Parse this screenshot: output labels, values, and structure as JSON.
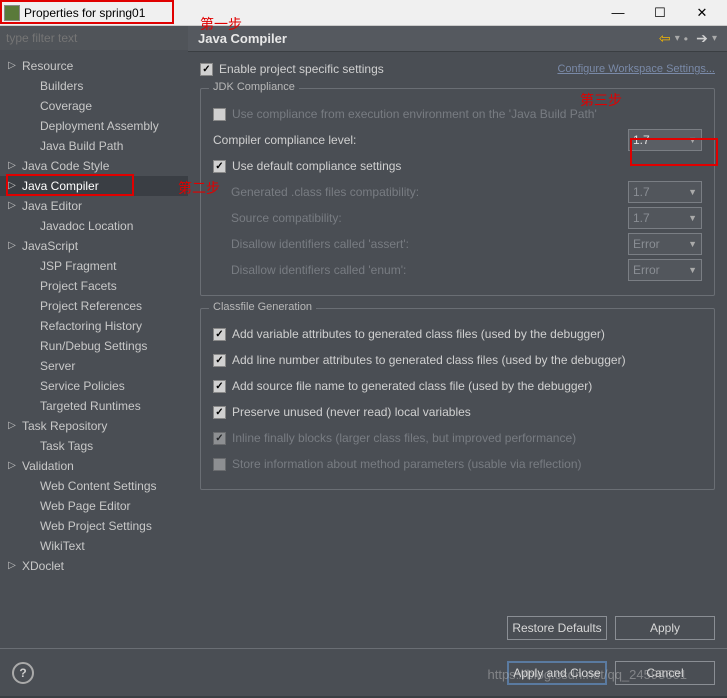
{
  "title": "Properties for spring01",
  "filter_placeholder": "type filter text",
  "tree": [
    {
      "label": "Resource",
      "exp": true,
      "child": false
    },
    {
      "label": "Builders",
      "exp": false,
      "child": true
    },
    {
      "label": "Coverage",
      "exp": false,
      "child": true
    },
    {
      "label": "Deployment Assembly",
      "exp": false,
      "child": true
    },
    {
      "label": "Java Build Path",
      "exp": false,
      "child": true
    },
    {
      "label": "Java Code Style",
      "exp": true,
      "child": false
    },
    {
      "label": "Java Compiler",
      "exp": true,
      "child": false,
      "selected": true
    },
    {
      "label": "Java Editor",
      "exp": true,
      "child": false
    },
    {
      "label": "Javadoc Location",
      "exp": false,
      "child": true
    },
    {
      "label": "JavaScript",
      "exp": true,
      "child": false
    },
    {
      "label": "JSP Fragment",
      "exp": false,
      "child": true
    },
    {
      "label": "Project Facets",
      "exp": false,
      "child": true
    },
    {
      "label": "Project References",
      "exp": false,
      "child": true
    },
    {
      "label": "Refactoring History",
      "exp": false,
      "child": true
    },
    {
      "label": "Run/Debug Settings",
      "exp": false,
      "child": true
    },
    {
      "label": "Server",
      "exp": false,
      "child": true
    },
    {
      "label": "Service Policies",
      "exp": false,
      "child": true
    },
    {
      "label": "Targeted Runtimes",
      "exp": false,
      "child": true
    },
    {
      "label": "Task Repository",
      "exp": true,
      "child": false
    },
    {
      "label": "Task Tags",
      "exp": false,
      "child": true
    },
    {
      "label": "Validation",
      "exp": true,
      "child": false
    },
    {
      "label": "Web Content Settings",
      "exp": false,
      "child": true
    },
    {
      "label": "Web Page Editor",
      "exp": false,
      "child": true
    },
    {
      "label": "Web Project Settings",
      "exp": false,
      "child": true
    },
    {
      "label": "WikiText",
      "exp": false,
      "child": true
    },
    {
      "label": "XDoclet",
      "exp": true,
      "child": false
    }
  ],
  "header": {
    "title": "Java Compiler"
  },
  "enable_specific": "Enable project specific settings",
  "configure_link": "Configure Workspace Settings...",
  "jdk": {
    "group": "JDK Compliance",
    "use_exec_env": "Use compliance from execution environment on the 'Java Build Path'",
    "compliance_label": "Compiler compliance level:",
    "compliance_value": "1.7",
    "use_default": "Use default compliance settings",
    "gen_compat": "Generated .class files compatibility:",
    "gen_compat_val": "1.7",
    "src_compat": "Source compatibility:",
    "src_compat_val": "1.7",
    "assert": "Disallow identifiers called 'assert':",
    "assert_val": "Error",
    "enum": "Disallow identifiers called 'enum':",
    "enum_val": "Error"
  },
  "classfile": {
    "group": "Classfile Generation",
    "var_attr": "Add variable attributes to generated class files (used by the debugger)",
    "line_attr": "Add line number attributes to generated class files (used by the debugger)",
    "src_file": "Add source file name to generated class file (used by the debugger)",
    "preserve": "Preserve unused (never read) local variables",
    "inline": "Inline finally blocks (larger class files, but improved performance)",
    "method_params": "Store information about method parameters (usable via reflection)"
  },
  "buttons": {
    "restore": "Restore Defaults",
    "apply": "Apply",
    "apply_close": "Apply and Close",
    "cancel": "Cancel"
  },
  "annotations": {
    "step1": "第一步",
    "step2": "第二步",
    "step3": "第三步"
  },
  "watermark": "https://blog.csdn.net/qq_24598601"
}
